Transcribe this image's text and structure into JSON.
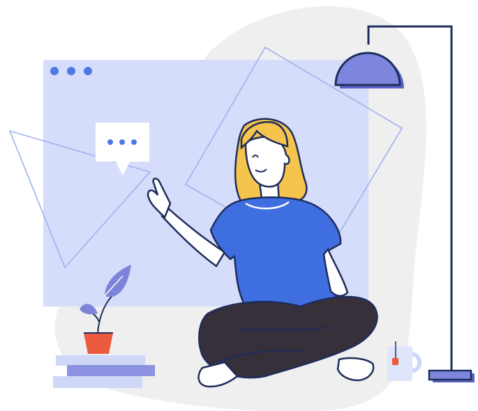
{
  "scene": {
    "kind": "flat illustration",
    "window_dots": 3,
    "speech_bubble_dots": 3
  },
  "colors": {
    "blob": "#efefef",
    "window": "#d5ddfa",
    "window_dot": "#4f78e4",
    "outline_light": "#9fb2ee",
    "outline_dark": "#1f2c5c",
    "lamp_shade": "#7b86dc",
    "lamp_shade_shadow": "#5a64c4",
    "shirt": "#3f6ee0",
    "pants": "#35303a",
    "hair": "#f4c44d",
    "pot": "#ec5b3e",
    "leaf": "#7d83d8",
    "book_light": "#cfd7f7",
    "book_dark": "#8b93e0",
    "tea_tag": "#ec5b3e",
    "white": "#ffffff"
  },
  "icons": {
    "bubble": "speech-bubble-icon",
    "plant": "plant-icon",
    "lamp": "floor-lamp-icon",
    "mug": "mug-icon",
    "books": "books-icon"
  }
}
